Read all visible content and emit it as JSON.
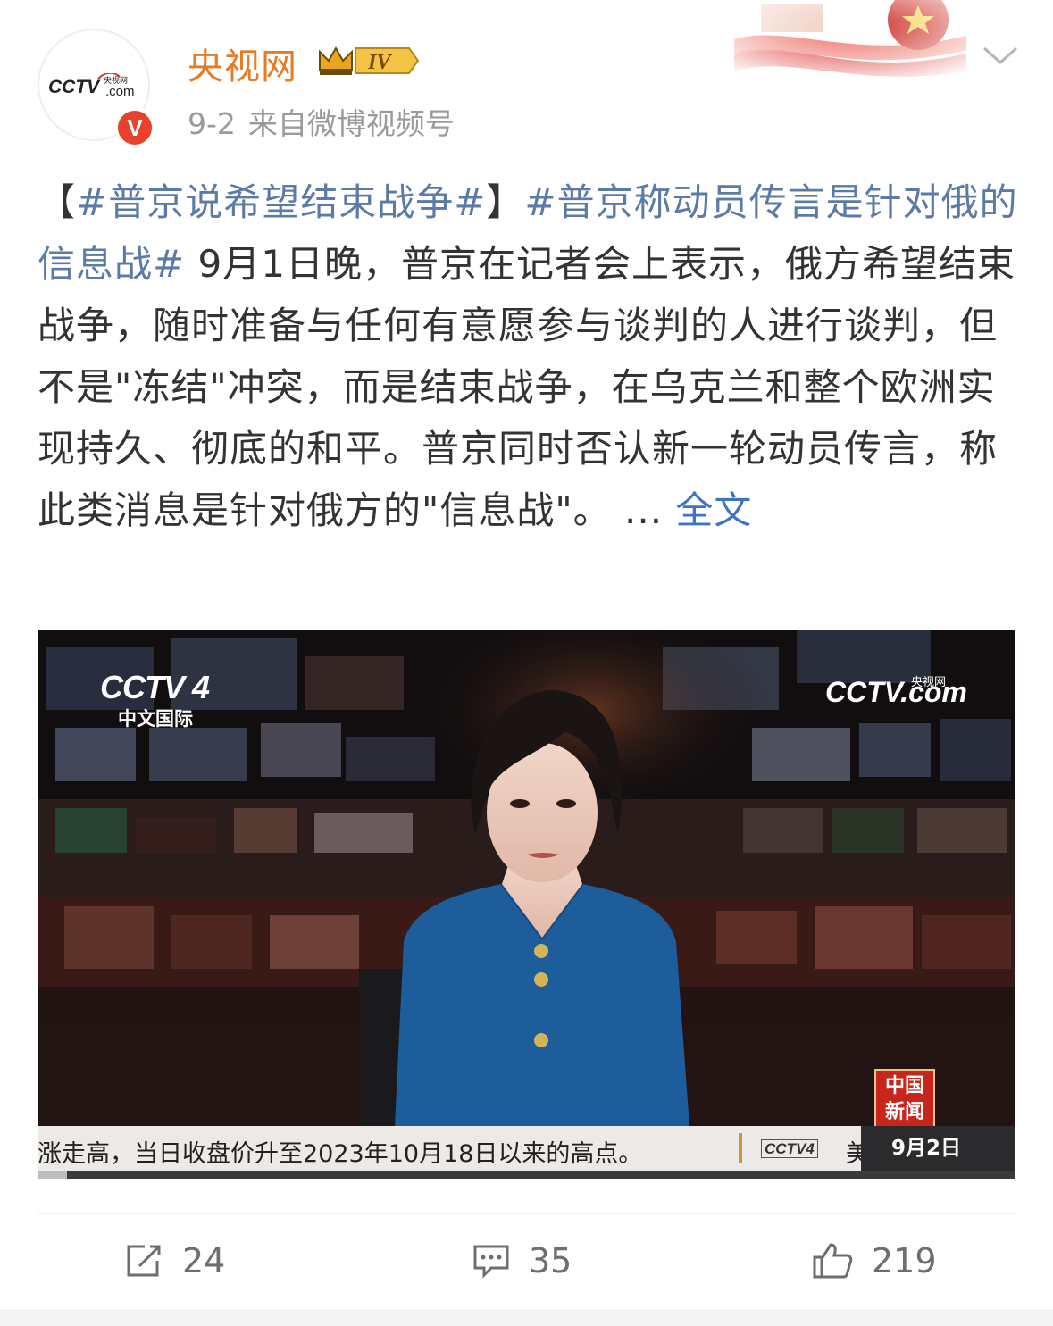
{
  "author": {
    "name": "央视网",
    "verified_badge": "V",
    "vip_level": "IV",
    "avatar_logo": "CCTV.com 央视网"
  },
  "meta": {
    "date": "9-2",
    "source": "来自微博视频号"
  },
  "post": {
    "open_bracket": "【",
    "tag1": "#普京说希望结束战争#",
    "close_bracket": "】",
    "tag2": "#普京称动员传言是针对俄的信息战#",
    "body": " 9月1日晚，普京在记者会上表示，俄方希望结束战争，随时准备与任何有意愿参与谈判的人进行谈判，但不是\"冻结\"冲突，而是结束战争，在乌克兰和整个欧洲实现持久、彻底的和平。普京同时否认新一轮动员传言，称此类消息是针对俄方的\"信息战\"。 ",
    "ellipsis": " ... ",
    "more_link": "全文"
  },
  "video": {
    "channel_logo": "CCTV 4",
    "channel_name": "中文国际",
    "watermark": "CCTV.com",
    "watermark_small": "央视网",
    "program_badge_line1": "中国",
    "program_badge_line2": "新闻",
    "ticker_text": "涨走高，当日收盘价升至2023年10月18日以来的高点。",
    "ticker_logo": "CCTV4",
    "ticker_more": "美",
    "ticker_date": "9月2日",
    "progress": 0.03
  },
  "actions": {
    "reposts": "24",
    "comments": "35",
    "likes": "219"
  },
  "colors": {
    "author_name": "#e97a22",
    "tag": "#5b7ba6",
    "link": "#3e74c1",
    "verified": "#e8412c",
    "jacket": "#1e5d9c"
  },
  "icons": [
    "verified-icon",
    "crown-icon",
    "chevron-down-icon",
    "repost-icon",
    "comment-icon",
    "like-icon"
  ]
}
